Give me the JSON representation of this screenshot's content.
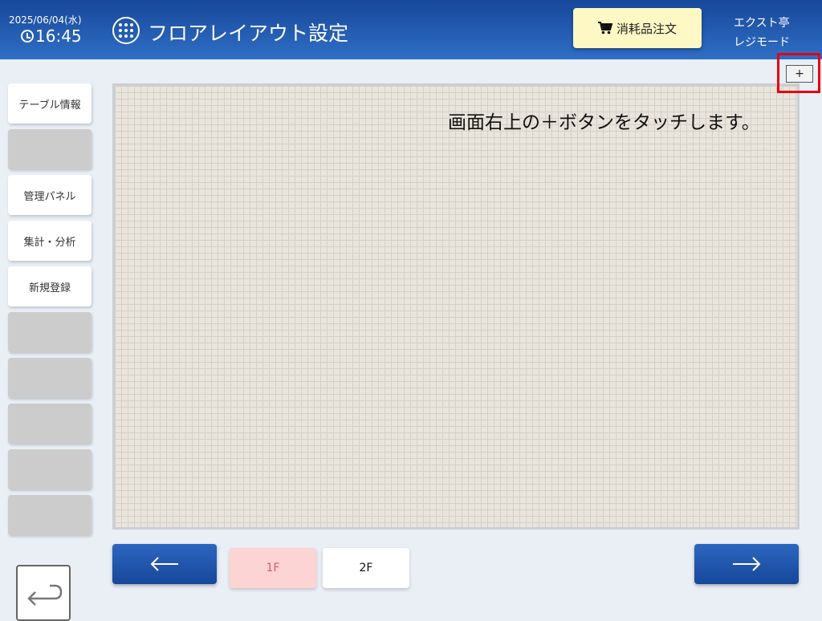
{
  "header": {
    "date": "2025/06/04(水)",
    "time": "16:45",
    "title": "フロアレイアウト設定",
    "order_label": "消耗品注文",
    "shop_name": "エクスト亭",
    "mode": "レジモード",
    "icons": {
      "clock": "clock-icon",
      "menu": "grid-menu-icon",
      "cart": "cart-icon"
    }
  },
  "sidebar": {
    "items": [
      {
        "label": "テーブル情報",
        "empty": false
      },
      {
        "label": "",
        "empty": true
      },
      {
        "label": "管理パネル",
        "empty": false
      },
      {
        "label": "集計・分析",
        "empty": false
      },
      {
        "label": "新規登録",
        "empty": false
      },
      {
        "label": "",
        "empty": true
      },
      {
        "label": "",
        "empty": true
      },
      {
        "label": "",
        "empty": true
      },
      {
        "label": "",
        "empty": true
      },
      {
        "label": "",
        "empty": true
      }
    ]
  },
  "canvas": {
    "instruction": "画面右上の＋ボタンをタッチします。",
    "add_label": "+"
  },
  "footer": {
    "floors": [
      "1F",
      "2F"
    ],
    "selected_floor": "1F",
    "icons": {
      "prev": "arrow-left-icon",
      "next": "arrow-right-icon",
      "back": "return-icon"
    }
  },
  "colors": {
    "header": "#1f56ad",
    "highlight": "#e60012",
    "order_button": "#fdf8c4",
    "selected_floor": "#fdd4d4",
    "nav_button": "#1f56ad"
  }
}
